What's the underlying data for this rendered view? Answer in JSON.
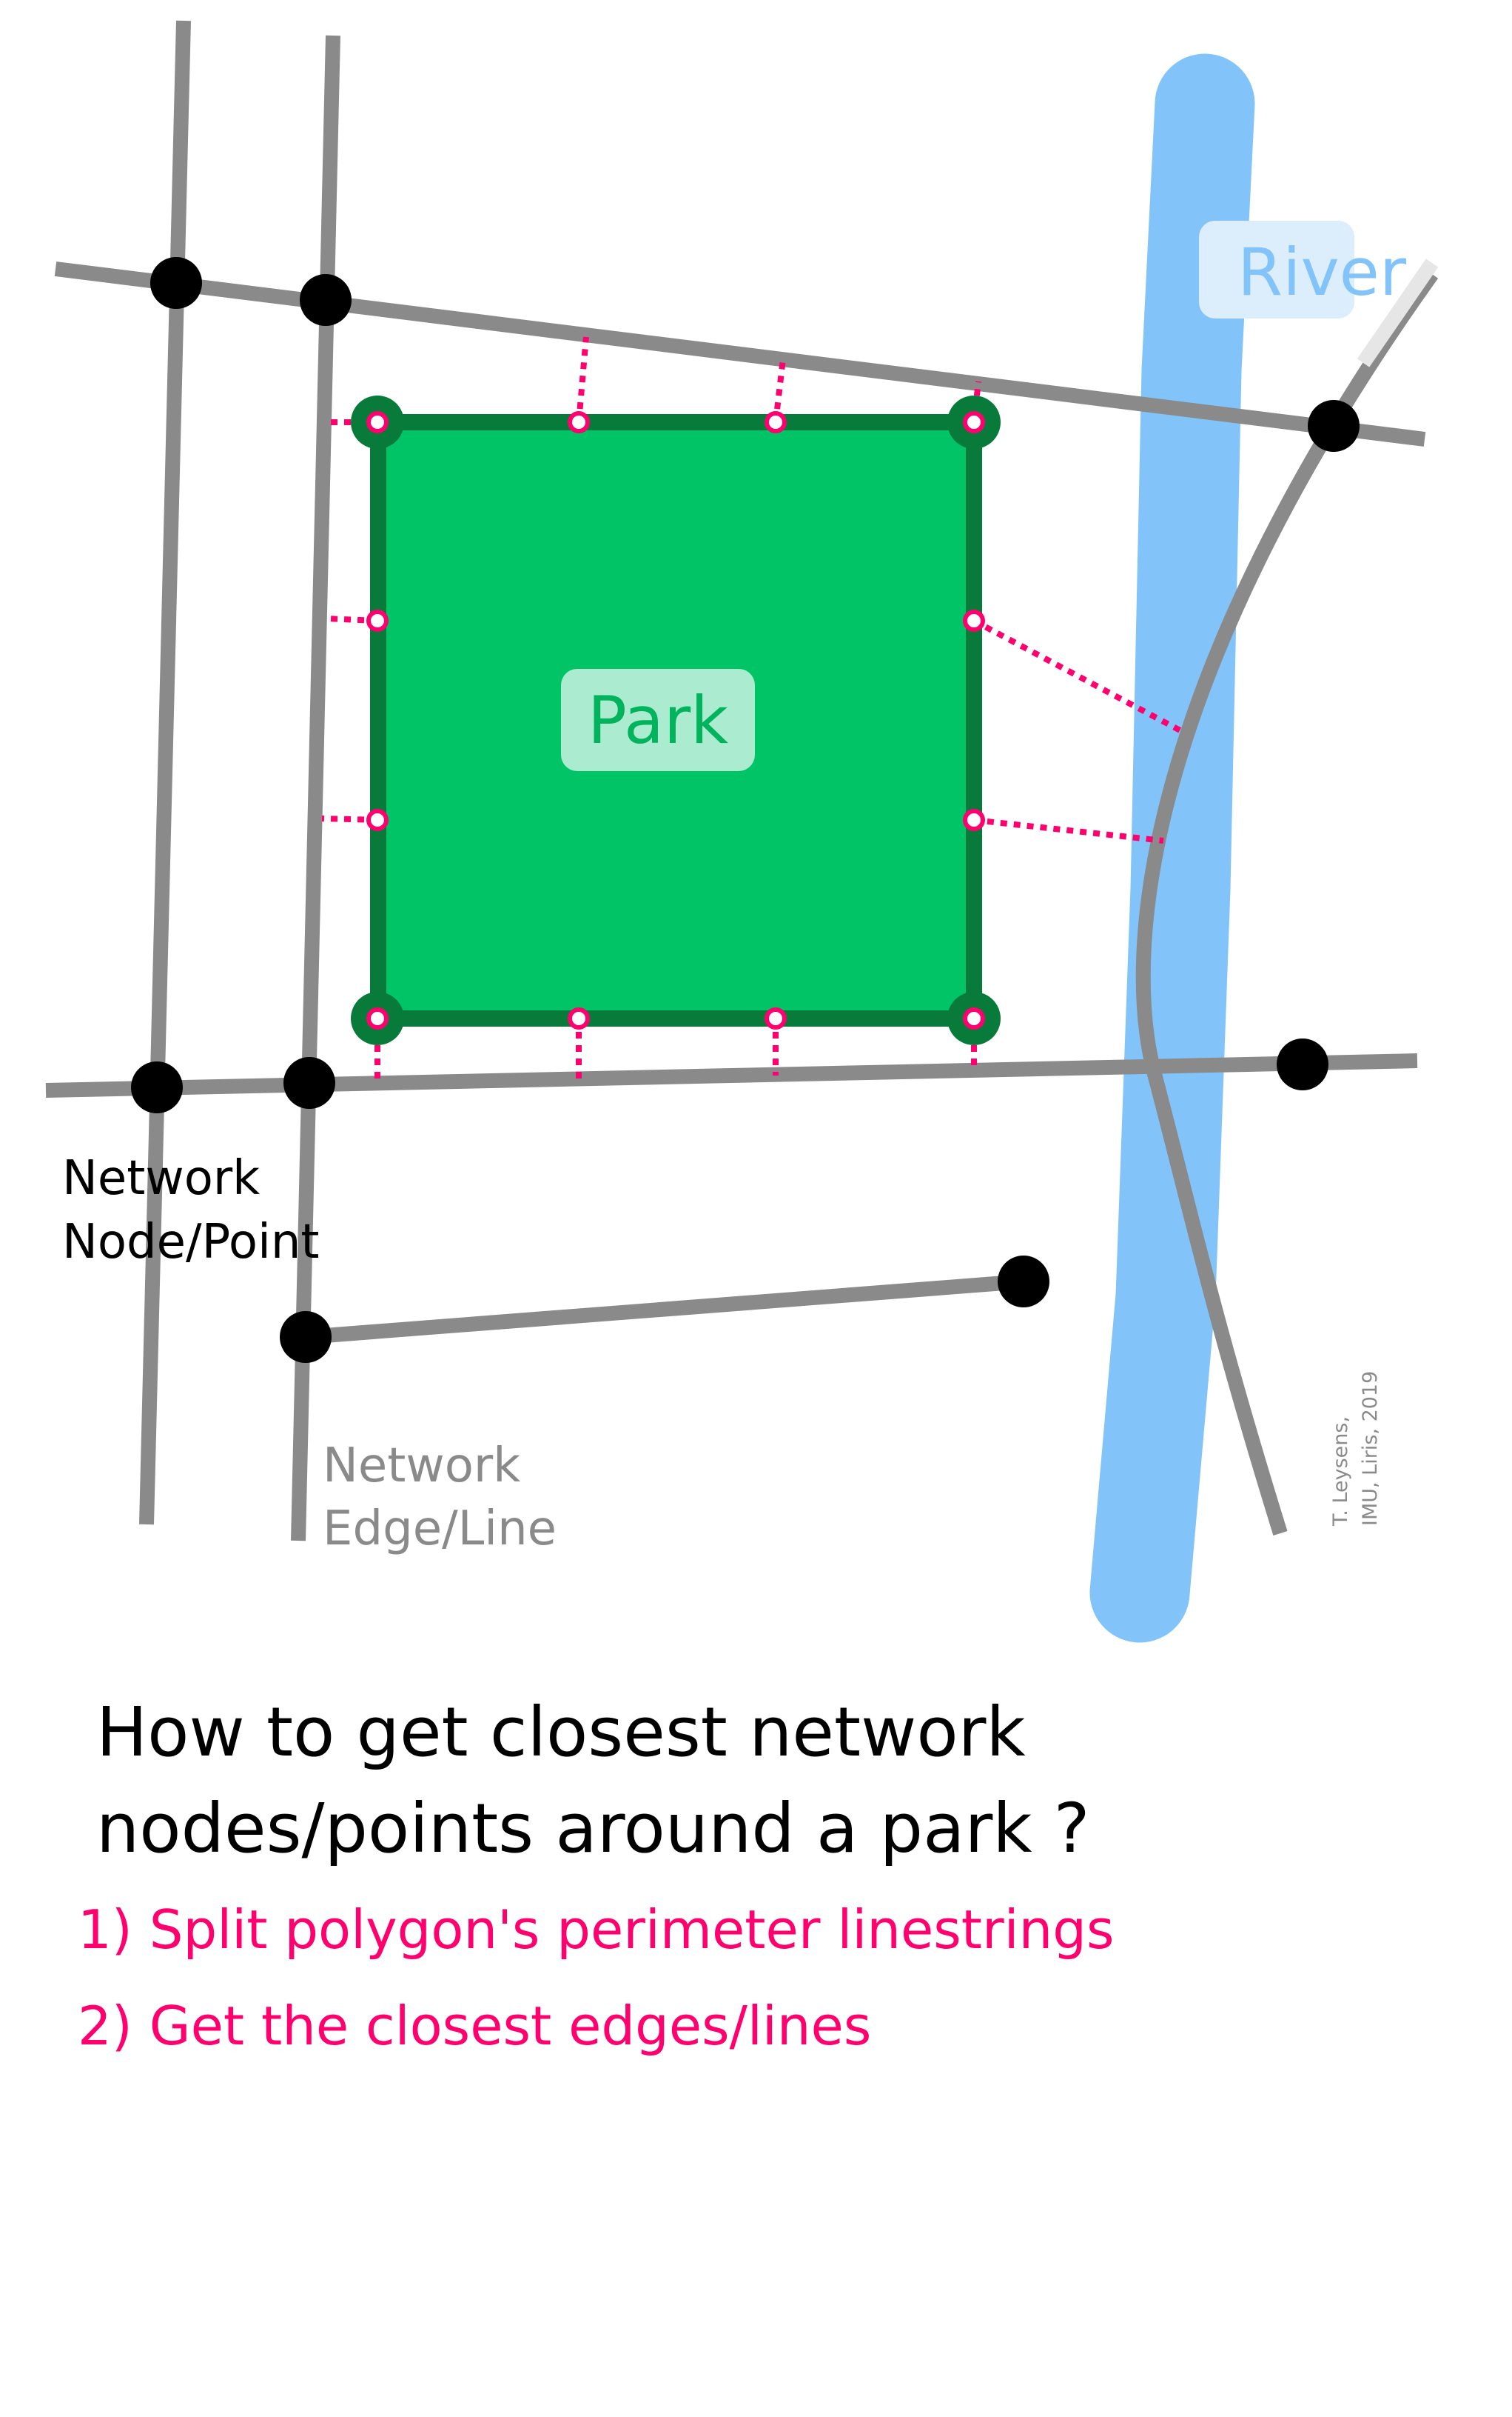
{
  "colors": {
    "road": "#8a8a8a",
    "node": "#000000",
    "river": "#82c4fa",
    "park_fill": "#00c466",
    "park_border": "#087a3a",
    "link": "#ff006e",
    "accent_text": "#ff006e",
    "park_label_bg": "#abecd0"
  },
  "labels": {
    "river": "River",
    "park": "Park",
    "node_line1": "Network",
    "node_line2": "Node/Point",
    "edge_line1": "Network",
    "edge_line2": "Edge/Line",
    "credit_line1": "T. Leysens,",
    "credit_line2": "IMU, Liris, 2019"
  },
  "question": {
    "line1": "How to get closest network",
    "line2": "nodes/points around a park ?"
  },
  "steps": [
    "1) Split polygon's perimeter linestrings",
    "2) Get the closest edges/lines"
  ]
}
